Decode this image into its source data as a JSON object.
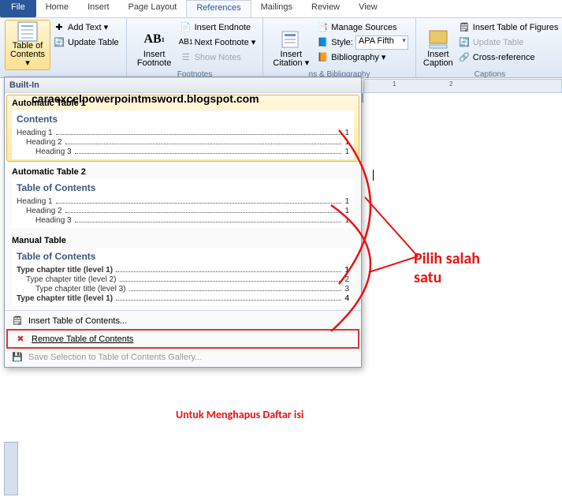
{
  "tabs": [
    "File",
    "Home",
    "Insert",
    "Page Layout",
    "References",
    "Mailings",
    "Review",
    "View"
  ],
  "ribbon": {
    "toc": {
      "label": "Table of\nContents ▾",
      "add": "Add Text ▾",
      "update": "Update Table"
    },
    "foot": {
      "big": "Insert\nFootnote",
      "end": "Insert Endnote",
      "next": "Next Footnote ▾",
      "show": "Show Notes",
      "label": "Footnotes"
    },
    "cite": {
      "big": "Insert\nCitation ▾",
      "manage": "Manage Sources",
      "style_lbl": "Style:",
      "style_val": "APA Fifth",
      "bib": "Bibliography ▾",
      "label": "ns & Bibliography"
    },
    "cap": {
      "big": "Insert\nCaption",
      "figs": "Insert Table of Figures",
      "update": "Update Table",
      "xref": "Cross-reference",
      "label": "Captions"
    }
  },
  "gallery": {
    "builtin": "Built-In",
    "a1": {
      "title": "Automatic Table 1",
      "hd": "Contents",
      "rows": [
        [
          "Heading 1",
          "1"
        ],
        [
          "Heading 2",
          "1"
        ],
        [
          "Heading 3",
          "1"
        ]
      ]
    },
    "a2": {
      "title": "Automatic Table 2",
      "hd": "Table of Contents",
      "rows": [
        [
          "Heading 1",
          "1"
        ],
        [
          "Heading 2",
          "1"
        ],
        [
          "Heading 3",
          "1"
        ]
      ]
    },
    "m": {
      "title": "Manual Table",
      "hd": "Table of Contents",
      "rows": [
        [
          "Type chapter title (level 1)",
          "1"
        ],
        [
          "Type chapter title (level 2)",
          "2"
        ],
        [
          "Type chapter title (level 3)",
          "3"
        ],
        [
          "Type chapter title (level 1)",
          "4"
        ]
      ]
    },
    "foot": {
      "insert": "Insert Table of Contents...",
      "remove": "Remove Table of Contents",
      "save": "Save Selection to Table of Contents Gallery..."
    }
  },
  "ruler": {
    "t1": "1",
    "t2": "2"
  },
  "anno1": "Pilih salah\nsatu",
  "anno2": "Untuk Menghapus Daftar isi",
  "watermark": "caraexcelpowerpointmsword.blogspot.com"
}
